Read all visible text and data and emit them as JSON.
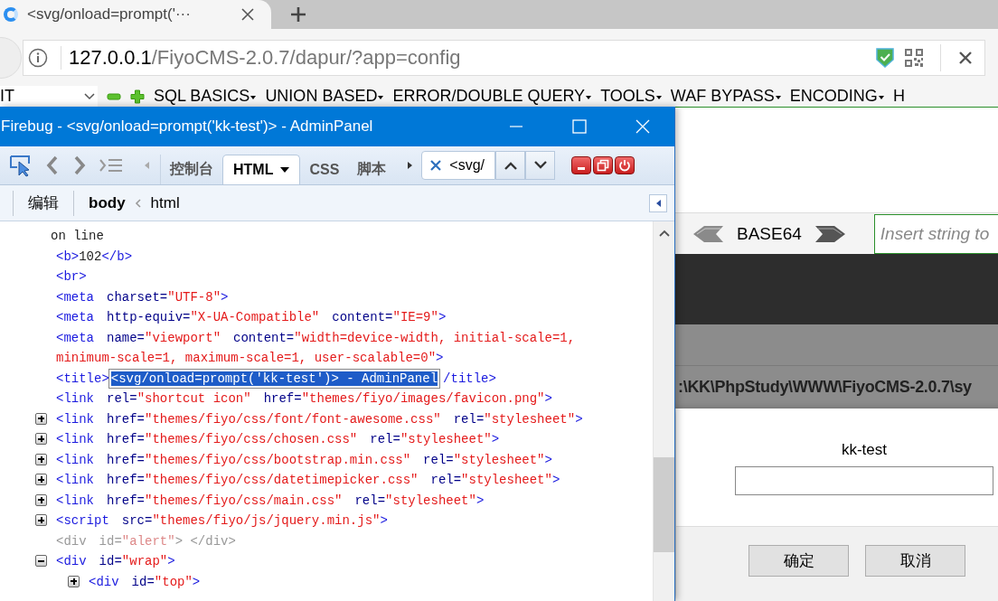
{
  "browser": {
    "tab": {
      "title": "<svg/onload=prompt('···"
    },
    "url": {
      "host": "127.0.0.1",
      "path": "/FiyoCMS-2.0.7/dapur/?app=config"
    }
  },
  "hackbar": {
    "select_value": "IT",
    "menus": [
      "SQL BASICS",
      "UNION BASED",
      "ERROR/DOUBLE QUERY",
      "TOOLS",
      "WAF BYPASS",
      "ENCODING",
      "H"
    ],
    "encoding": "BASE64",
    "input_placeholder": "Insert string to"
  },
  "page": {
    "path_text": ":\\KK\\PhpStudy\\WWW\\FiyoCMS-2.0.7\\sy"
  },
  "dialog": {
    "message": "kk-test",
    "buttons": [
      "确定",
      "取消"
    ]
  },
  "firebug": {
    "title": "Firebug - <svg/onload=prompt('kk-test')> - AdminPanel",
    "panels": [
      {
        "label": "控制台",
        "selected": false
      },
      {
        "label": "HTML",
        "selected": true
      },
      {
        "label": "CSS",
        "selected": false
      },
      {
        "label": "脚本",
        "selected": false
      }
    ],
    "search_value": "<svg/",
    "edit_label": "编辑",
    "breadcrumbs": [
      "body",
      "html"
    ],
    "lines": [
      {
        "muted": false,
        "parts": [
          {
            "kind": "text",
            "text": "on line"
          }
        ]
      },
      {
        "muted": false,
        "parts": [
          {
            "kind": "tag",
            "text": "<b>"
          },
          {
            "kind": "text",
            "text": "102"
          },
          {
            "kind": "tag",
            "text": "</b>"
          }
        ]
      },
      {
        "muted": false,
        "parts": [
          {
            "kind": "tag",
            "text": "<br>"
          }
        ]
      },
      {
        "muted": false,
        "parts": [
          {
            "kind": "tag",
            "text": "<meta"
          },
          {
            "kind": "attr",
            "text": "charset="
          },
          {
            "kind": "value",
            "text": "\"UTF-8\""
          },
          {
            "kind": "tag",
            "text": ">"
          }
        ]
      },
      {
        "muted": false,
        "parts": [
          {
            "kind": "tag",
            "text": "<meta"
          },
          {
            "kind": "attr",
            "text": "http-equiv="
          },
          {
            "kind": "value",
            "text": "\"X-UA-Compatible\""
          },
          {
            "kind": "attr",
            "text": "content="
          },
          {
            "kind": "value",
            "text": "\"IE=9\""
          },
          {
            "kind": "tag",
            "text": ">"
          }
        ]
      },
      {
        "muted": false,
        "parts": [
          {
            "kind": "tag",
            "text": "<meta"
          },
          {
            "kind": "attr",
            "text": "name="
          },
          {
            "kind": "value",
            "text": "\"viewport\""
          },
          {
            "kind": "attr",
            "text": "content="
          },
          {
            "kind": "value",
            "text": "\"width=device-width, initial-scale=1, minimum-scale=1, maximum-scale=1, user-scalable=0\""
          },
          {
            "kind": "tag",
            "text": ">"
          }
        ]
      },
      {
        "muted": false,
        "parts": [
          {
            "kind": "tag",
            "text": "<title>"
          },
          {
            "kind": "editor",
            "text": "<svg/onload=prompt('kk-test')> - AdminPanel"
          },
          {
            "kind": "tag",
            "text": "/title>"
          }
        ]
      },
      {
        "muted": false,
        "parts": [
          {
            "kind": "tag",
            "text": "<link"
          },
          {
            "kind": "attr",
            "text": "rel="
          },
          {
            "kind": "value",
            "text": "\"shortcut icon\""
          },
          {
            "kind": "attr",
            "text": "href="
          },
          {
            "kind": "value",
            "text": "\"themes/fiyo/images/favicon.png\""
          },
          {
            "kind": "tag",
            "text": ">"
          }
        ]
      },
      {
        "expanded": false,
        "muted": false,
        "parts": [
          {
            "kind": "tag",
            "text": "<link"
          },
          {
            "kind": "attr",
            "text": "href="
          },
          {
            "kind": "value",
            "text": "\"themes/fiyo/css/font/font-awesome.css\""
          },
          {
            "kind": "attr",
            "text": "rel="
          },
          {
            "kind": "value",
            "text": "\"stylesheet\""
          },
          {
            "kind": "tag",
            "text": ">"
          }
        ]
      },
      {
        "expanded": false,
        "muted": false,
        "parts": [
          {
            "kind": "tag",
            "text": "<link"
          },
          {
            "kind": "attr",
            "text": "href="
          },
          {
            "kind": "value",
            "text": "\"themes/fiyo/css/chosen.css\""
          },
          {
            "kind": "attr",
            "text": "rel="
          },
          {
            "kind": "value",
            "text": "\"stylesheet\""
          },
          {
            "kind": "tag",
            "text": ">"
          }
        ]
      },
      {
        "expanded": false,
        "muted": false,
        "parts": [
          {
            "kind": "tag",
            "text": "<link"
          },
          {
            "kind": "attr",
            "text": "href="
          },
          {
            "kind": "value",
            "text": "\"themes/fiyo/css/bootstrap.min.css\""
          },
          {
            "kind": "attr",
            "text": "rel="
          },
          {
            "kind": "value",
            "text": "\"stylesheet\""
          },
          {
            "kind": "tag",
            "text": ">"
          }
        ]
      },
      {
        "expanded": false,
        "muted": false,
        "parts": [
          {
            "kind": "tag",
            "text": "<link"
          },
          {
            "kind": "attr",
            "text": "href="
          },
          {
            "kind": "value",
            "text": "\"themes/fiyo/css/datetimepicker.css\""
          },
          {
            "kind": "attr",
            "text": "rel="
          },
          {
            "kind": "value",
            "text": "\"stylesheet\""
          },
          {
            "kind": "tag",
            "text": ">"
          }
        ]
      },
      {
        "expanded": false,
        "muted": false,
        "parts": [
          {
            "kind": "tag",
            "text": "<link"
          },
          {
            "kind": "attr",
            "text": "href="
          },
          {
            "kind": "value",
            "text": "\"themes/fiyo/css/main.css\""
          },
          {
            "kind": "attr",
            "text": "rel="
          },
          {
            "kind": "value",
            "text": "\"stylesheet\""
          },
          {
            "kind": "tag",
            "text": ">"
          }
        ]
      },
      {
        "expanded": false,
        "muted": false,
        "parts": [
          {
            "kind": "tag",
            "text": "<script"
          },
          {
            "kind": "attr",
            "text": "src="
          },
          {
            "kind": "value",
            "text": "\"themes/fiyo/js/jquery.min.js\""
          },
          {
            "kind": "tag",
            "text": ">"
          }
        ]
      },
      {
        "muted": true,
        "parts": [
          {
            "kind": "tag",
            "text": "<div"
          },
          {
            "kind": "attr",
            "text": "id="
          },
          {
            "kind": "value",
            "text": "\"alert\""
          },
          {
            "kind": "tag",
            "text": "> </div>"
          }
        ]
      },
      {
        "expanded": true,
        "muted": false,
        "parts": [
          {
            "kind": "tag",
            "text": "<div"
          },
          {
            "kind": "attr",
            "text": "id="
          },
          {
            "kind": "value",
            "text": "\"wrap\""
          },
          {
            "kind": "tag",
            "text": ">"
          }
        ],
        "children": [
          {
            "expanded": false,
            "muted": false,
            "parts": [
              {
                "kind": "tag",
                "text": "<div"
              },
              {
                "kind": "attr",
                "text": "id="
              },
              {
                "kind": "value",
                "text": "\"top\""
              },
              {
                "kind": "tag",
                "text": ">"
              }
            ]
          }
        ]
      }
    ]
  }
}
